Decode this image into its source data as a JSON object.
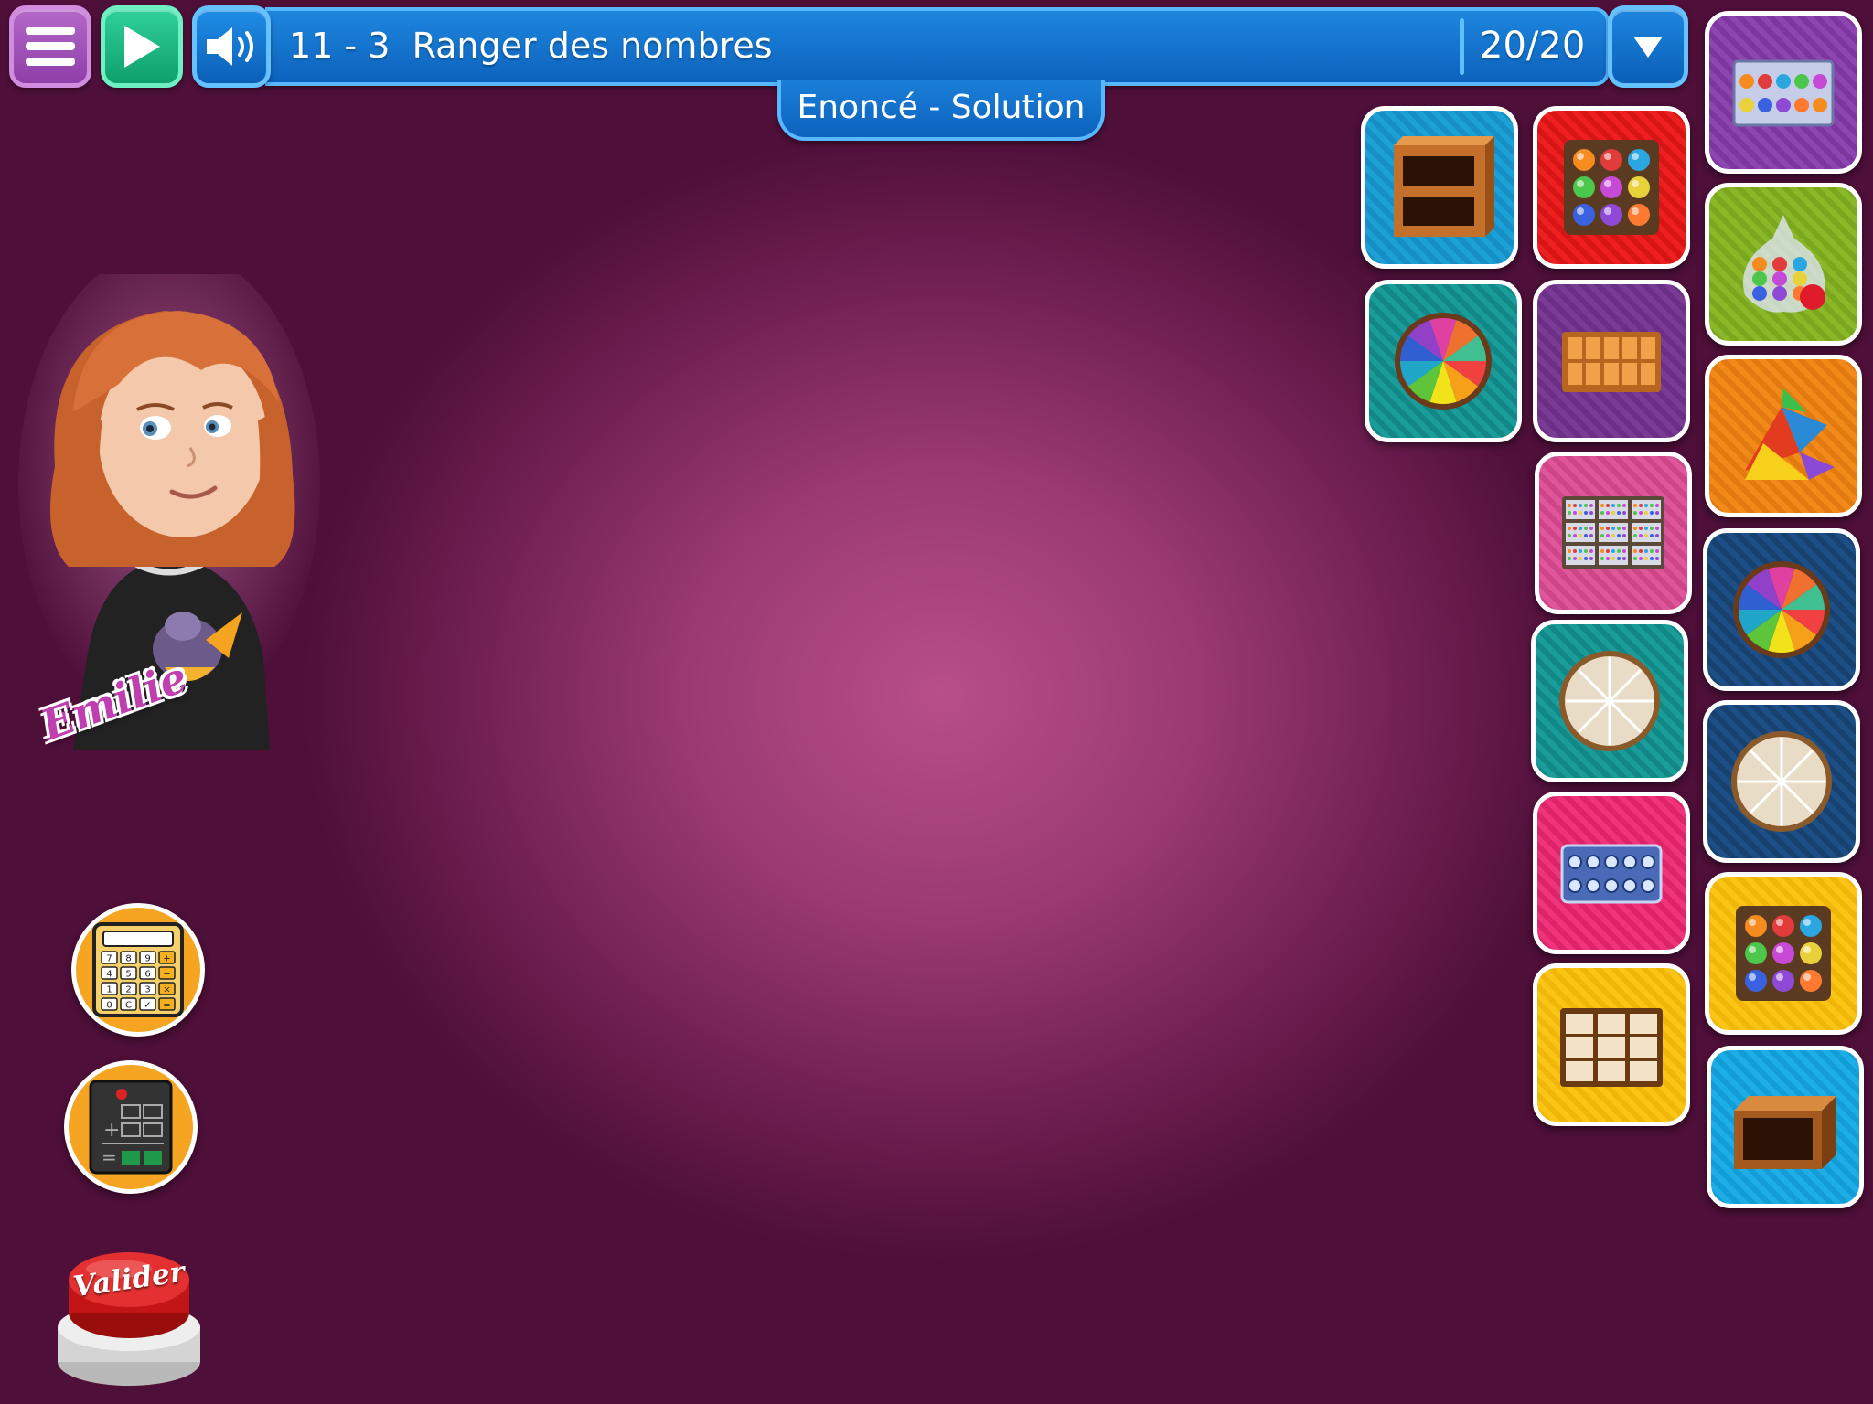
{
  "header": {
    "exercise_number": "11 - 3",
    "exercise_title": "Ranger des nombres",
    "progress": "20/20",
    "tab_label": "Enoncé - Solution"
  },
  "character": {
    "name": "Emilie"
  },
  "actions": {
    "validate_label": "Valider"
  },
  "calculator_keys": [
    "7",
    "8",
    "9",
    "+",
    "4",
    "5",
    "6",
    "−",
    "1",
    "2",
    "3",
    "×",
    "0",
    "C",
    "✓",
    "="
  ],
  "tools": [
    {
      "id": "shelf-2",
      "icon": "shelf-two-compartments-icon",
      "color": "#1ca0d6"
    },
    {
      "id": "beads-9-red",
      "icon": "marble-tray-9-icon",
      "color": "#ee1f1f"
    },
    {
      "id": "beads-10",
      "icon": "marble-rack-10-icon",
      "color": "#8d45b0"
    },
    {
      "id": "wheel-color",
      "icon": "color-fraction-wheel-icon",
      "color": "#199c9a"
    },
    {
      "id": "tray-10",
      "icon": "tray-10-compartments-icon",
      "color": "#7a3b95"
    },
    {
      "id": "candy-bag",
      "icon": "candy-bag-icon",
      "color": "#8ab828"
    },
    {
      "id": "abacus-grid",
      "icon": "abacus-grid-icon",
      "color": "#e0569a"
    },
    {
      "id": "tangram",
      "icon": "tangram-pieces-icon",
      "color": "#f28a1a"
    },
    {
      "id": "pie-plain",
      "icon": "plain-fraction-pie-icon",
      "color": "#199c9a"
    },
    {
      "id": "wheel-color-2",
      "icon": "color-fraction-wheel-icon",
      "color": "#1e4e86"
    },
    {
      "id": "pie-plain-2",
      "icon": "plain-fraction-pie-icon",
      "color": "#1e4e86"
    },
    {
      "id": "egg-box",
      "icon": "egg-box-10-icon",
      "color": "#f0337a"
    },
    {
      "id": "beads-9-yellow",
      "icon": "marble-tray-9-icon",
      "color": "#fbc515"
    },
    {
      "id": "box-grid",
      "icon": "box-grid-9-icon",
      "color": "#fbc515"
    },
    {
      "id": "shelf-1",
      "icon": "open-box-icon",
      "color": "#1daee8"
    }
  ]
}
